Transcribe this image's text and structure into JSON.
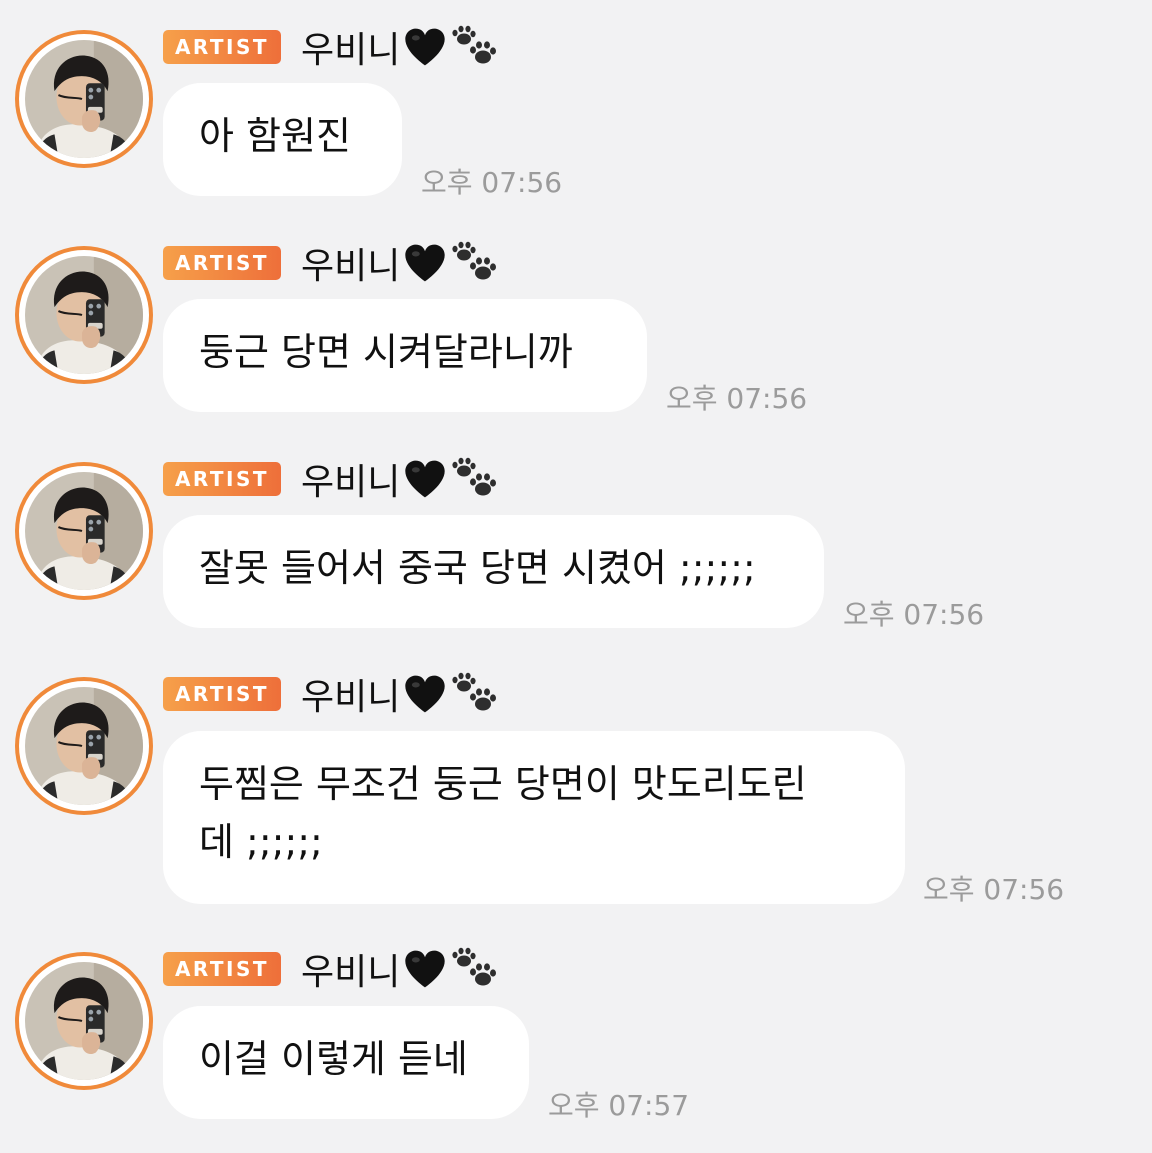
{
  "messages": [
    {
      "badge": "ARTIST",
      "name": "우비니",
      "text": "아 함원진",
      "time": "오후 07:56"
    },
    {
      "badge": "ARTIST",
      "name": "우비니",
      "text": "둥근 당면 시켜달라니까",
      "time": "오후 07:56"
    },
    {
      "badge": "ARTIST",
      "name": "우비니",
      "text": "잘못 들어서 중국 당면 시켰어 ;;;;;;",
      "time": "오후 07:56"
    },
    {
      "badge": "ARTIST",
      "name": "우비니",
      "text": "두찜은 무조건 둥근 당면이 맛도리도린\n데 ;;;;;;",
      "time": "오후 07:56"
    },
    {
      "badge": "ARTIST",
      "name": "우비니",
      "text": "이걸 이렇게 듣네",
      "time": "오후 07:57"
    }
  ],
  "icons": {
    "heart": "black-heart-icon",
    "paw": "paw-prints-icon"
  },
  "colors": {
    "background": "#f2f2f3",
    "bubble": "#ffffff",
    "badge_start": "#f6a04a",
    "badge_end": "#ee6f3a",
    "avatar_ring": "#f08a3a",
    "time": "#9b9b9b"
  }
}
